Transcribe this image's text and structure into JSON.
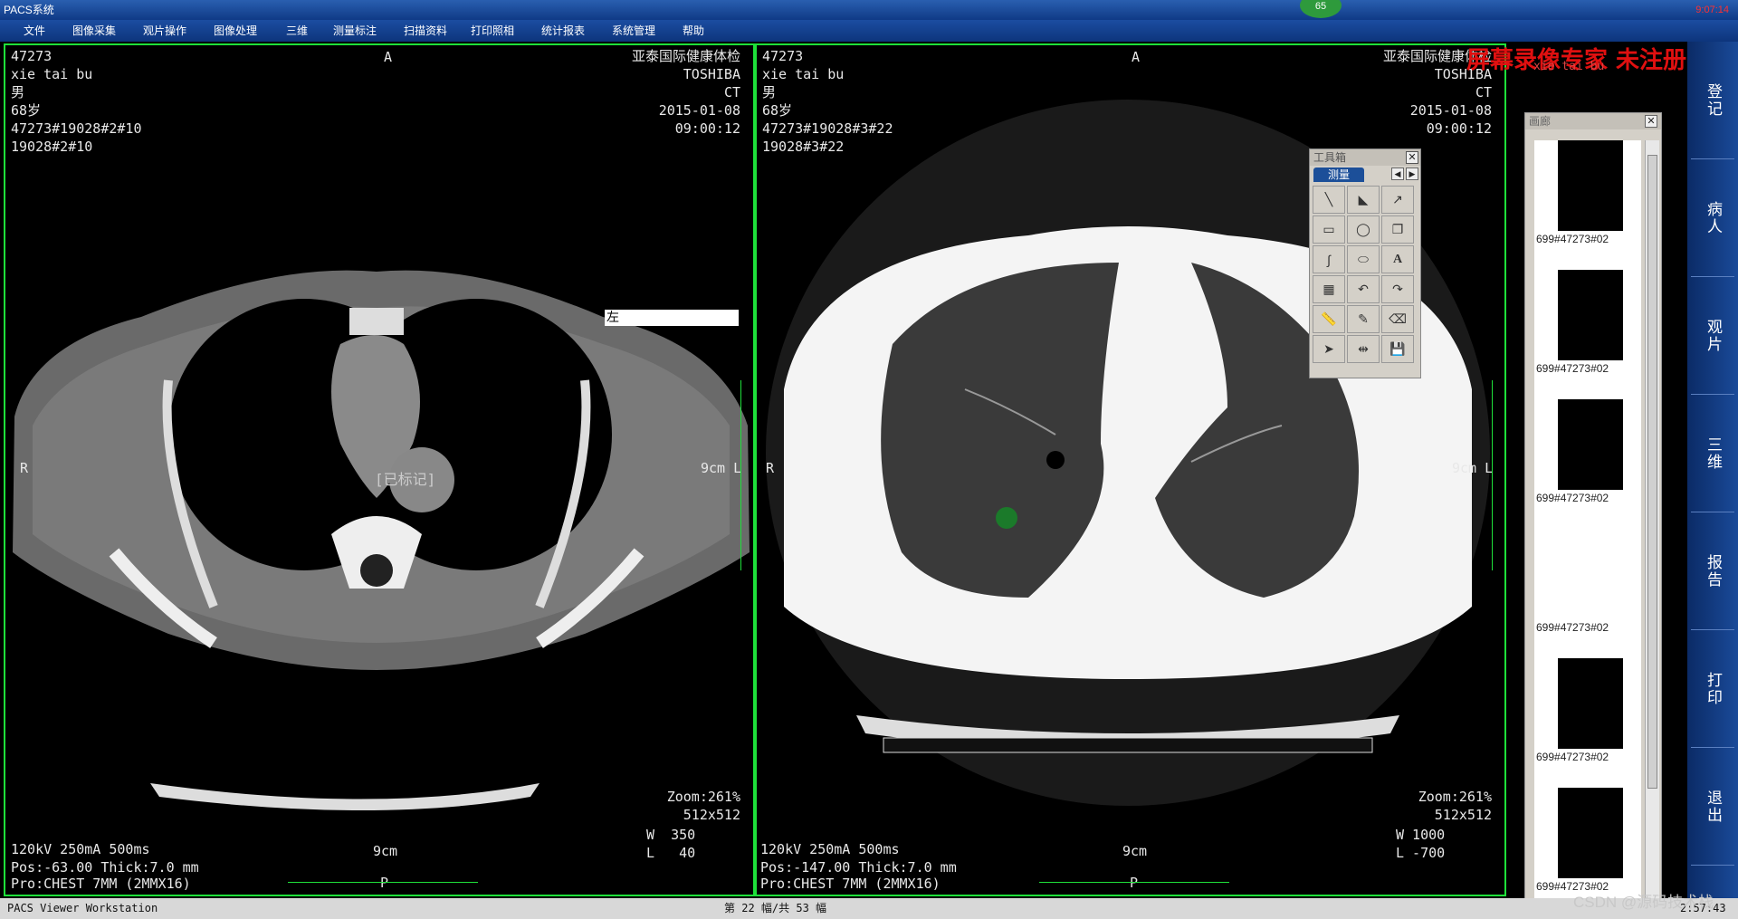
{
  "window": {
    "title": "PACS系统",
    "indicator": "65",
    "clock": "9:07:14"
  },
  "menu": [
    "文件",
    "图像采集",
    "观片操作",
    "图像处理",
    "三维",
    "测量标注",
    "扫描资料",
    "打印照相",
    "统计报表",
    "系统管理",
    "帮助"
  ],
  "viewports": [
    {
      "id": "47273",
      "name": "xie tai bu",
      "sex": "男",
      "age": "68岁",
      "series": "47273#19028#2#10",
      "image": "19028#2#10",
      "hospital": "亚泰国际健康体检",
      "maker": "TOSHIBA",
      "modality": "CT",
      "date": "2015-01-08",
      "time": "09:00:12",
      "orient_top": "A",
      "orient_left": "R",
      "orient_right": "9cm L",
      "orient_bottom": "P",
      "zoom": "Zoom:261%",
      "matrix": "512x512",
      "scale": "9cm",
      "kv": "120kV 250mA 500ms",
      "pos": "Pos:-63.00 Thick:7.0 mm",
      "protocol": "Pro:CHEST 7MM (2MMX16)",
      "ww": "W  350",
      "wl": "L   40",
      "label_side": "左",
      "label_marked": "[已标记]"
    },
    {
      "id": "47273",
      "name": "xie tai bu",
      "sex": "男",
      "age": "68岁",
      "series": "47273#19028#3#22",
      "image": "19028#3#22",
      "hospital": "亚泰国际健康体检",
      "maker": "TOSHIBA",
      "modality": "CT",
      "date": "2015-01-08",
      "time": "09:00:12",
      "orient_top": "A",
      "orient_left": "R",
      "orient_right": "9cm L",
      "orient_bottom": "P",
      "zoom": "Zoom:261%",
      "matrix": "512x512",
      "scale": "9cm",
      "kv": "120kV 250mA 500ms",
      "pos": "Pos:-147.00 Thick:7.0 mm",
      "protocol": "Pro:CHEST 7MM (2MMX16)",
      "ww": "W 1000",
      "wl": "L -700"
    }
  ],
  "toolbox": {
    "title": "工具箱",
    "tab": "测量",
    "tools": [
      "line-tool-icon",
      "angle-tool-icon",
      "arrow-tool-icon",
      "rectangle-tool-icon",
      "ellipse-tool-icon",
      "copy-tool-icon",
      "freehand-tool-icon",
      "polygon-tool-icon",
      "text-tool-icon",
      "color-tool-icon",
      "undo-tool-icon",
      "redo-tool-icon",
      "ruler-tool-icon",
      "calibrate-tool-icon",
      "eraser-tool-icon",
      "pointer-tool-icon",
      "distance-tool-icon",
      "save-tool-icon"
    ],
    "text_tool_label": "A"
  },
  "thumbnails": {
    "title": "画廊",
    "items": [
      "699#47273#02",
      "699#47273#02",
      "699#47273#02",
      "699#47273#02",
      "699#47273#02",
      "699#47273#02",
      "699#47273#02"
    ]
  },
  "watermark": "屏幕录像专家 未注册",
  "watermark_sub": "xie tai bu",
  "sidebar": [
    "登记",
    "病人",
    "观片",
    "三维",
    "报告",
    "打印",
    "退出"
  ],
  "status": {
    "left": "PACS Viewer Workstation",
    "center": "第 22 幅/共 53 幅",
    "right": "2:57:43"
  },
  "csdn": "CSDN @源码技术栈",
  "colors": {
    "viewport_border": "#1ee03a",
    "watermark": "#e01010",
    "titlebar": "#1b4da1"
  }
}
